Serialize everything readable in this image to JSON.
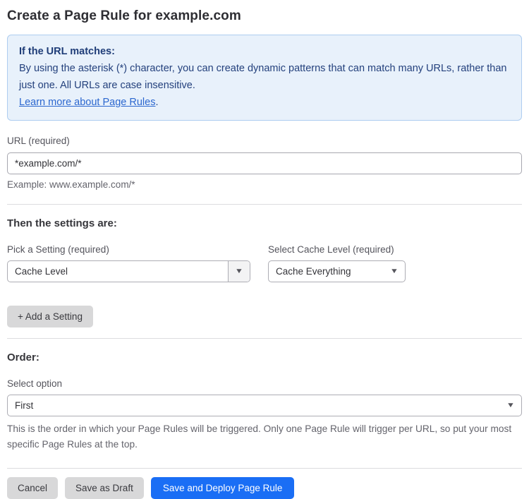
{
  "page": {
    "title": "Create a Page Rule for example.com"
  },
  "info_box": {
    "heading": "If the URL matches:",
    "body": "By using the asterisk (*) character, you can create dynamic patterns that can match many URLs, rather than just one. All URLs are case insensitive.",
    "link_label": "Learn more about Page Rules",
    "link_suffix": "."
  },
  "url_field": {
    "label": "URL (required)",
    "value": "*example.com/*",
    "helper": "Example: www.example.com/*"
  },
  "settings_section": {
    "heading": "Then the settings are:",
    "setting_select": {
      "label": "Pick a Setting (required)",
      "value": "Cache Level"
    },
    "cache_level_select": {
      "label": "Select Cache Level (required)",
      "value": "Cache Everything"
    },
    "add_setting_label": "+ Add a Setting"
  },
  "order_section": {
    "heading": "Order:",
    "select_label": "Select option",
    "value": "First",
    "helper": "This is the order in which your Page Rules will be triggered. Only one Page Rule will trigger per URL, so put your most specific Page Rules at the top."
  },
  "actions": {
    "cancel": "Cancel",
    "save_draft": "Save as Draft",
    "save_deploy": "Save and Deploy Page Rule"
  },
  "icons": {
    "dropdown_arrow": "▼"
  },
  "colors": {
    "info_background": "#e8f1fb",
    "info_border": "#aecdf0",
    "info_text": "#24417d",
    "link_blue": "#2b67cf",
    "primary_blue": "#1a6ef5",
    "gray_button": "#d8d8d9"
  }
}
